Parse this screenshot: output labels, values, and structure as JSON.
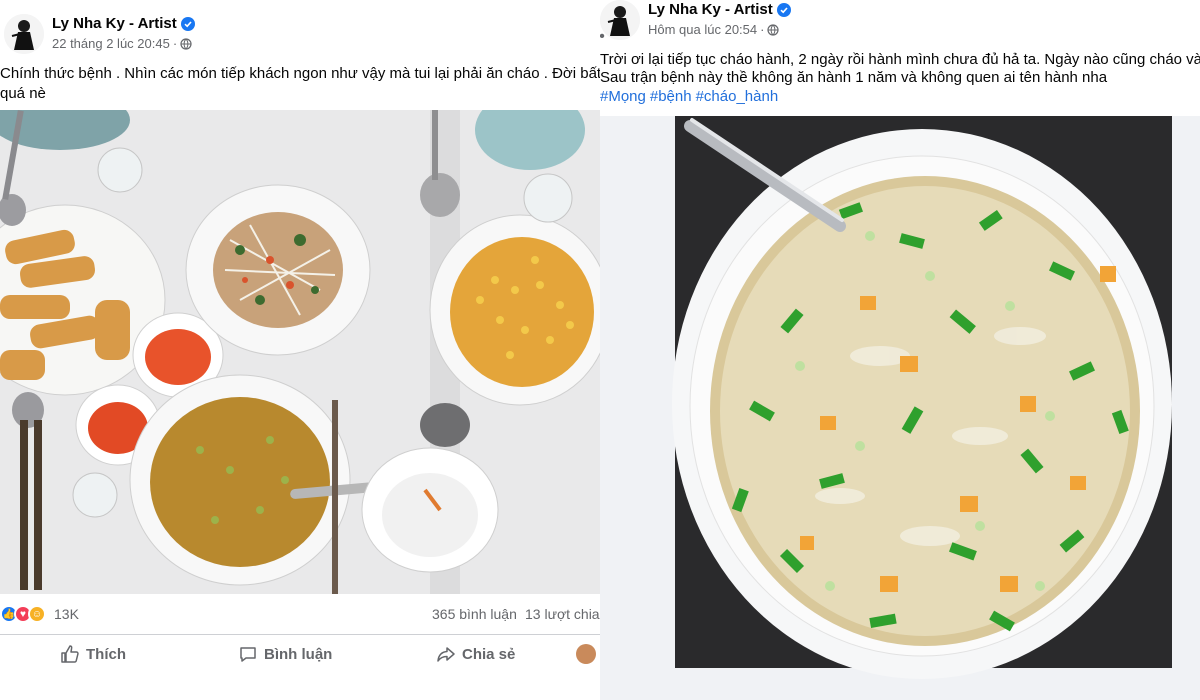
{
  "left_post": {
    "author": "Ly Nha Ky - Artist",
    "timestamp": "22 tháng 2 lúc 20:45",
    "separator": "·",
    "text_line1": "Chính thức bệnh . Nhìn các món tiếp khách ngon như vậy mà tui lại phải ăn cháo . Đời bất công",
    "text_line2": "quá nè",
    "reactions_count": "13K",
    "comments_count": "365 bình luận",
    "shares_count": "13 lượt chia",
    "actions": {
      "like": "Thích",
      "comment": "Bình luận",
      "share": "Chia sẻ"
    }
  },
  "right_post": {
    "author": "Ly Nha Ky - Artist",
    "timestamp": "Hôm qua lúc 20:54",
    "separator": "·",
    "text_line1": "Trời ơi lại tiếp tục cháo hành, 2 ngày rồi hành mình chưa đủ hả ta. Ngày nào cũng cháo và h",
    "text_line2": "Sau trận bệnh này thề không ăn hành 1 năm và không quen ai tên hành nha",
    "hashtags": [
      "#Mọng",
      "#bệnh",
      "#cháo_hành"
    ]
  },
  "icons": {
    "verified": "verified-badge-icon",
    "privacy": "globe-icon",
    "like": "thumbs-up-icon",
    "comment": "comment-bubble-icon",
    "share": "share-arrow-icon",
    "more": "more-dots-icon"
  },
  "colors": {
    "facebook_blue": "#1877f2",
    "hashtag": "#216fdb",
    "secondary_text": "#65676b",
    "divider": "#ced0d4"
  }
}
